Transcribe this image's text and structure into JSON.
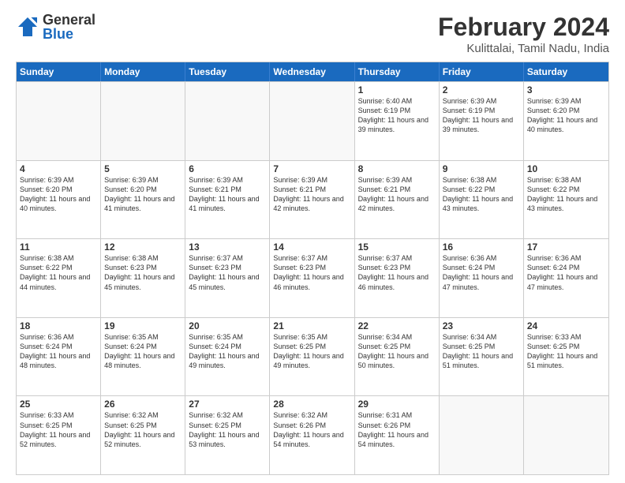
{
  "header": {
    "logo": {
      "general": "General",
      "blue": "Blue"
    },
    "title": "February 2024",
    "subtitle": "Kulittalai, Tamil Nadu, India"
  },
  "calendar": {
    "days": [
      "Sunday",
      "Monday",
      "Tuesday",
      "Wednesday",
      "Thursday",
      "Friday",
      "Saturday"
    ],
    "rows": [
      [
        {
          "date": "",
          "info": ""
        },
        {
          "date": "",
          "info": ""
        },
        {
          "date": "",
          "info": ""
        },
        {
          "date": "",
          "info": ""
        },
        {
          "date": "1",
          "info": "Sunrise: 6:40 AM\nSunset: 6:19 PM\nDaylight: 11 hours\nand 39 minutes."
        },
        {
          "date": "2",
          "info": "Sunrise: 6:39 AM\nSunset: 6:19 PM\nDaylight: 11 hours\nand 39 minutes."
        },
        {
          "date": "3",
          "info": "Sunrise: 6:39 AM\nSunset: 6:20 PM\nDaylight: 11 hours\nand 40 minutes."
        }
      ],
      [
        {
          "date": "4",
          "info": "Sunrise: 6:39 AM\nSunset: 6:20 PM\nDaylight: 11 hours\nand 40 minutes."
        },
        {
          "date": "5",
          "info": "Sunrise: 6:39 AM\nSunset: 6:20 PM\nDaylight: 11 hours\nand 41 minutes."
        },
        {
          "date": "6",
          "info": "Sunrise: 6:39 AM\nSunset: 6:21 PM\nDaylight: 11 hours\nand 41 minutes."
        },
        {
          "date": "7",
          "info": "Sunrise: 6:39 AM\nSunset: 6:21 PM\nDaylight: 11 hours\nand 42 minutes."
        },
        {
          "date": "8",
          "info": "Sunrise: 6:39 AM\nSunset: 6:21 PM\nDaylight: 11 hours\nand 42 minutes."
        },
        {
          "date": "9",
          "info": "Sunrise: 6:38 AM\nSunset: 6:22 PM\nDaylight: 11 hours\nand 43 minutes."
        },
        {
          "date": "10",
          "info": "Sunrise: 6:38 AM\nSunset: 6:22 PM\nDaylight: 11 hours\nand 43 minutes."
        }
      ],
      [
        {
          "date": "11",
          "info": "Sunrise: 6:38 AM\nSunset: 6:22 PM\nDaylight: 11 hours\nand 44 minutes."
        },
        {
          "date": "12",
          "info": "Sunrise: 6:38 AM\nSunset: 6:23 PM\nDaylight: 11 hours\nand 45 minutes."
        },
        {
          "date": "13",
          "info": "Sunrise: 6:37 AM\nSunset: 6:23 PM\nDaylight: 11 hours\nand 45 minutes."
        },
        {
          "date": "14",
          "info": "Sunrise: 6:37 AM\nSunset: 6:23 PM\nDaylight: 11 hours\nand 46 minutes."
        },
        {
          "date": "15",
          "info": "Sunrise: 6:37 AM\nSunset: 6:23 PM\nDaylight: 11 hours\nand 46 minutes."
        },
        {
          "date": "16",
          "info": "Sunrise: 6:36 AM\nSunset: 6:24 PM\nDaylight: 11 hours\nand 47 minutes."
        },
        {
          "date": "17",
          "info": "Sunrise: 6:36 AM\nSunset: 6:24 PM\nDaylight: 11 hours\nand 47 minutes."
        }
      ],
      [
        {
          "date": "18",
          "info": "Sunrise: 6:36 AM\nSunset: 6:24 PM\nDaylight: 11 hours\nand 48 minutes."
        },
        {
          "date": "19",
          "info": "Sunrise: 6:35 AM\nSunset: 6:24 PM\nDaylight: 11 hours\nand 48 minutes."
        },
        {
          "date": "20",
          "info": "Sunrise: 6:35 AM\nSunset: 6:24 PM\nDaylight: 11 hours\nand 49 minutes."
        },
        {
          "date": "21",
          "info": "Sunrise: 6:35 AM\nSunset: 6:25 PM\nDaylight: 11 hours\nand 49 minutes."
        },
        {
          "date": "22",
          "info": "Sunrise: 6:34 AM\nSunset: 6:25 PM\nDaylight: 11 hours\nand 50 minutes."
        },
        {
          "date": "23",
          "info": "Sunrise: 6:34 AM\nSunset: 6:25 PM\nDaylight: 11 hours\nand 51 minutes."
        },
        {
          "date": "24",
          "info": "Sunrise: 6:33 AM\nSunset: 6:25 PM\nDaylight: 11 hours\nand 51 minutes."
        }
      ],
      [
        {
          "date": "25",
          "info": "Sunrise: 6:33 AM\nSunset: 6:25 PM\nDaylight: 11 hours\nand 52 minutes."
        },
        {
          "date": "26",
          "info": "Sunrise: 6:32 AM\nSunset: 6:25 PM\nDaylight: 11 hours\nand 52 minutes."
        },
        {
          "date": "27",
          "info": "Sunrise: 6:32 AM\nSunset: 6:25 PM\nDaylight: 11 hours\nand 53 minutes."
        },
        {
          "date": "28",
          "info": "Sunrise: 6:32 AM\nSunset: 6:26 PM\nDaylight: 11 hours\nand 54 minutes."
        },
        {
          "date": "29",
          "info": "Sunrise: 6:31 AM\nSunset: 6:26 PM\nDaylight: 11 hours\nand 54 minutes."
        },
        {
          "date": "",
          "info": ""
        },
        {
          "date": "",
          "info": ""
        }
      ]
    ]
  }
}
